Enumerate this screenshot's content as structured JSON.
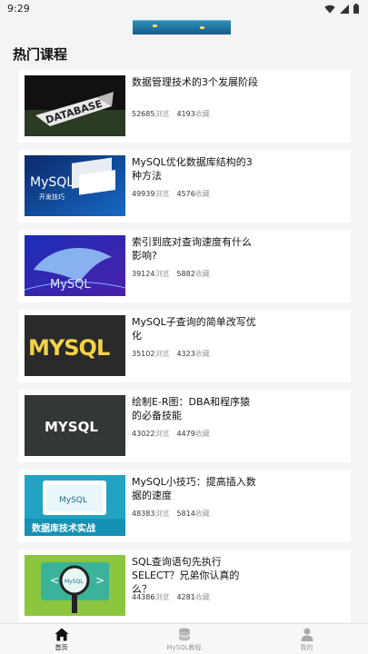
{
  "status_bar": {
    "time": "9:29",
    "icons": [
      "wifi-icon",
      "signal-icon",
      "battery-icon"
    ]
  },
  "section": {
    "title": "热门课程"
  },
  "courses": [
    {
      "title": "数据管理技术的3个发展阶段",
      "views": "52685",
      "views_unit": "浏览",
      "favs": "4193",
      "favs_unit": "收藏",
      "thumb_text": "DATABASE"
    },
    {
      "title": "MySQL优化数据库结构的3种方法",
      "views": "49939",
      "views_unit": "浏览",
      "favs": "4576",
      "favs_unit": "收藏",
      "thumb_text": "MySQL",
      "thumb_sub": "开发技巧"
    },
    {
      "title": "索引到底对查询速度有什么影响?",
      "views": "39124",
      "views_unit": "浏览",
      "favs": "5882",
      "favs_unit": "收藏",
      "thumb_text": "MySQL"
    },
    {
      "title": "MySQL子查询的简单改写优化",
      "views": "35102",
      "views_unit": "浏览",
      "favs": "4323",
      "favs_unit": "收藏",
      "thumb_text": "MYSQL"
    },
    {
      "title": "绘制E-R图：DBA和程序猿的必备技能",
      "views": "43022",
      "views_unit": "浏览",
      "favs": "4479",
      "favs_unit": "收藏",
      "thumb_text": "MYSQL"
    },
    {
      "title": "MySQL小技巧：提高插入数据的速度",
      "views": "48383",
      "views_unit": "浏览",
      "favs": "5814",
      "favs_unit": "收藏",
      "thumb_text": "MySQL",
      "thumb_sub": "数据库技术实战"
    },
    {
      "title": "SQL查询语句先执行SELECT？兄弟你认真的么？",
      "views": "44386",
      "views_unit": "浏览",
      "favs": "4281",
      "favs_unit": "收藏",
      "thumb_text": "MySQL"
    }
  ],
  "tabbar": {
    "tabs": [
      {
        "label": "首页",
        "icon": "home-icon",
        "active": true
      },
      {
        "label": "MySQL教程",
        "icon": "database-icon",
        "active": false
      },
      {
        "label": "我的",
        "icon": "person-icon",
        "active": false
      }
    ]
  },
  "colors": {
    "background": "#f4f4f4",
    "card": "#ffffff",
    "text": "#111111",
    "muted": "#999999"
  }
}
